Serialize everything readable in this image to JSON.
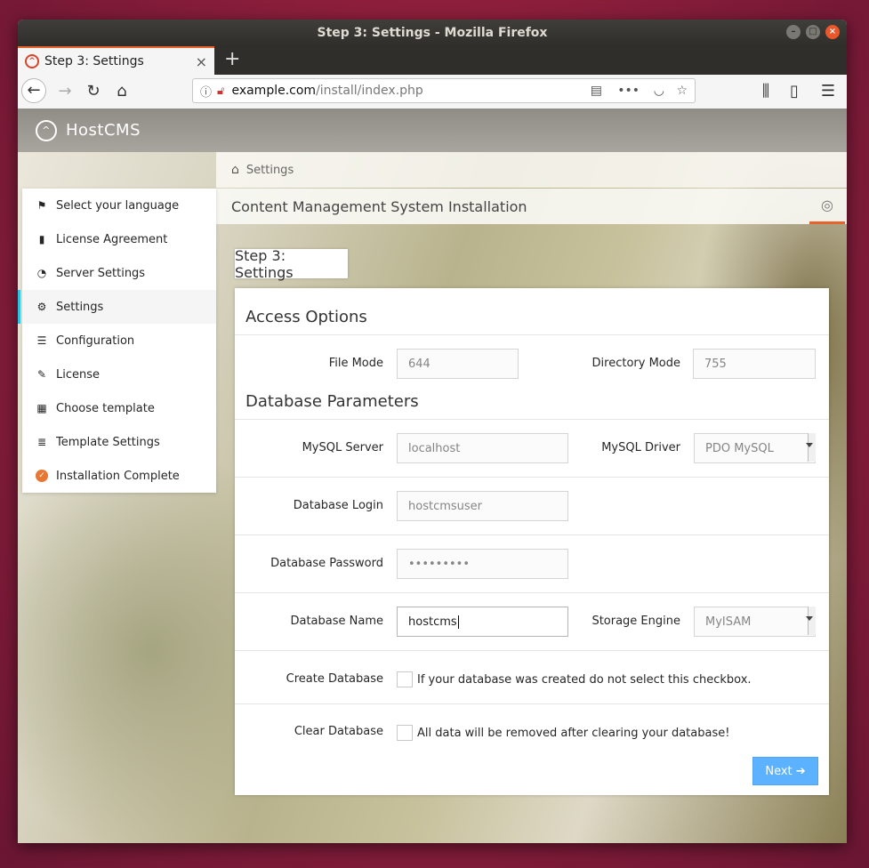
{
  "window": {
    "title": "Step 3: Settings - Mozilla Firefox",
    "buttons": [
      "–",
      "□",
      "×"
    ]
  },
  "browser": {
    "tab_title": "Step 3: Settings",
    "tab_close": "×",
    "new_tab": "+",
    "url_host": "example.com",
    "url_path": "/install/index.php",
    "page_actions": "•••"
  },
  "app": {
    "logo_text": "HostCMS",
    "breadcrumb": "Settings",
    "page_title": "Content Management System Installation"
  },
  "sidebar": {
    "items": [
      {
        "label": "Select your language",
        "icon": "flag-icon",
        "glyph": "⚑",
        "active": false
      },
      {
        "label": "License Agreement",
        "icon": "file-icon",
        "glyph": "▮",
        "active": false
      },
      {
        "label": "Server Settings",
        "icon": "dashboard-icon",
        "glyph": "◔",
        "active": false
      },
      {
        "label": "Settings",
        "icon": "gear-icon",
        "glyph": "⚙",
        "active": true
      },
      {
        "label": "Configuration",
        "icon": "list-icon",
        "glyph": "☰",
        "active": false
      },
      {
        "label": "License",
        "icon": "edit-icon",
        "glyph": "✎",
        "active": false
      },
      {
        "label": "Choose template",
        "icon": "grid-icon",
        "glyph": "▦",
        "active": false
      },
      {
        "label": "Template Settings",
        "icon": "server-icon",
        "glyph": "≣",
        "active": false
      },
      {
        "label": "Installation Complete",
        "icon": "check-circle-icon",
        "glyph": "✓",
        "active": false
      }
    ]
  },
  "step": {
    "tab_label": "Step 3: Settings"
  },
  "form": {
    "access_title": "Access Options",
    "file_mode_label": "File Mode",
    "file_mode_value": "644",
    "dir_mode_label": "Directory Mode",
    "dir_mode_value": "755",
    "db_title": "Database Parameters",
    "mysql_server_label": "MySQL Server",
    "mysql_server_value": "localhost",
    "mysql_driver_label": "MySQL Driver",
    "mysql_driver_value": "PDO MySQL",
    "db_login_label": "Database Login",
    "db_login_value": "hostcmsuser",
    "db_password_label": "Database Password",
    "db_password_value": "•••••••••",
    "db_name_label": "Database Name",
    "db_name_value": "hostcms",
    "storage_engine_label": "Storage Engine",
    "storage_engine_value": "MyISAM",
    "create_db_label": "Create Database",
    "create_db_hint": "If your database was created do not select this checkbox.",
    "clear_db_label": "Clear Database",
    "clear_db_hint": "All data will be removed after clearing your database!",
    "next_label": "Next ➔"
  }
}
